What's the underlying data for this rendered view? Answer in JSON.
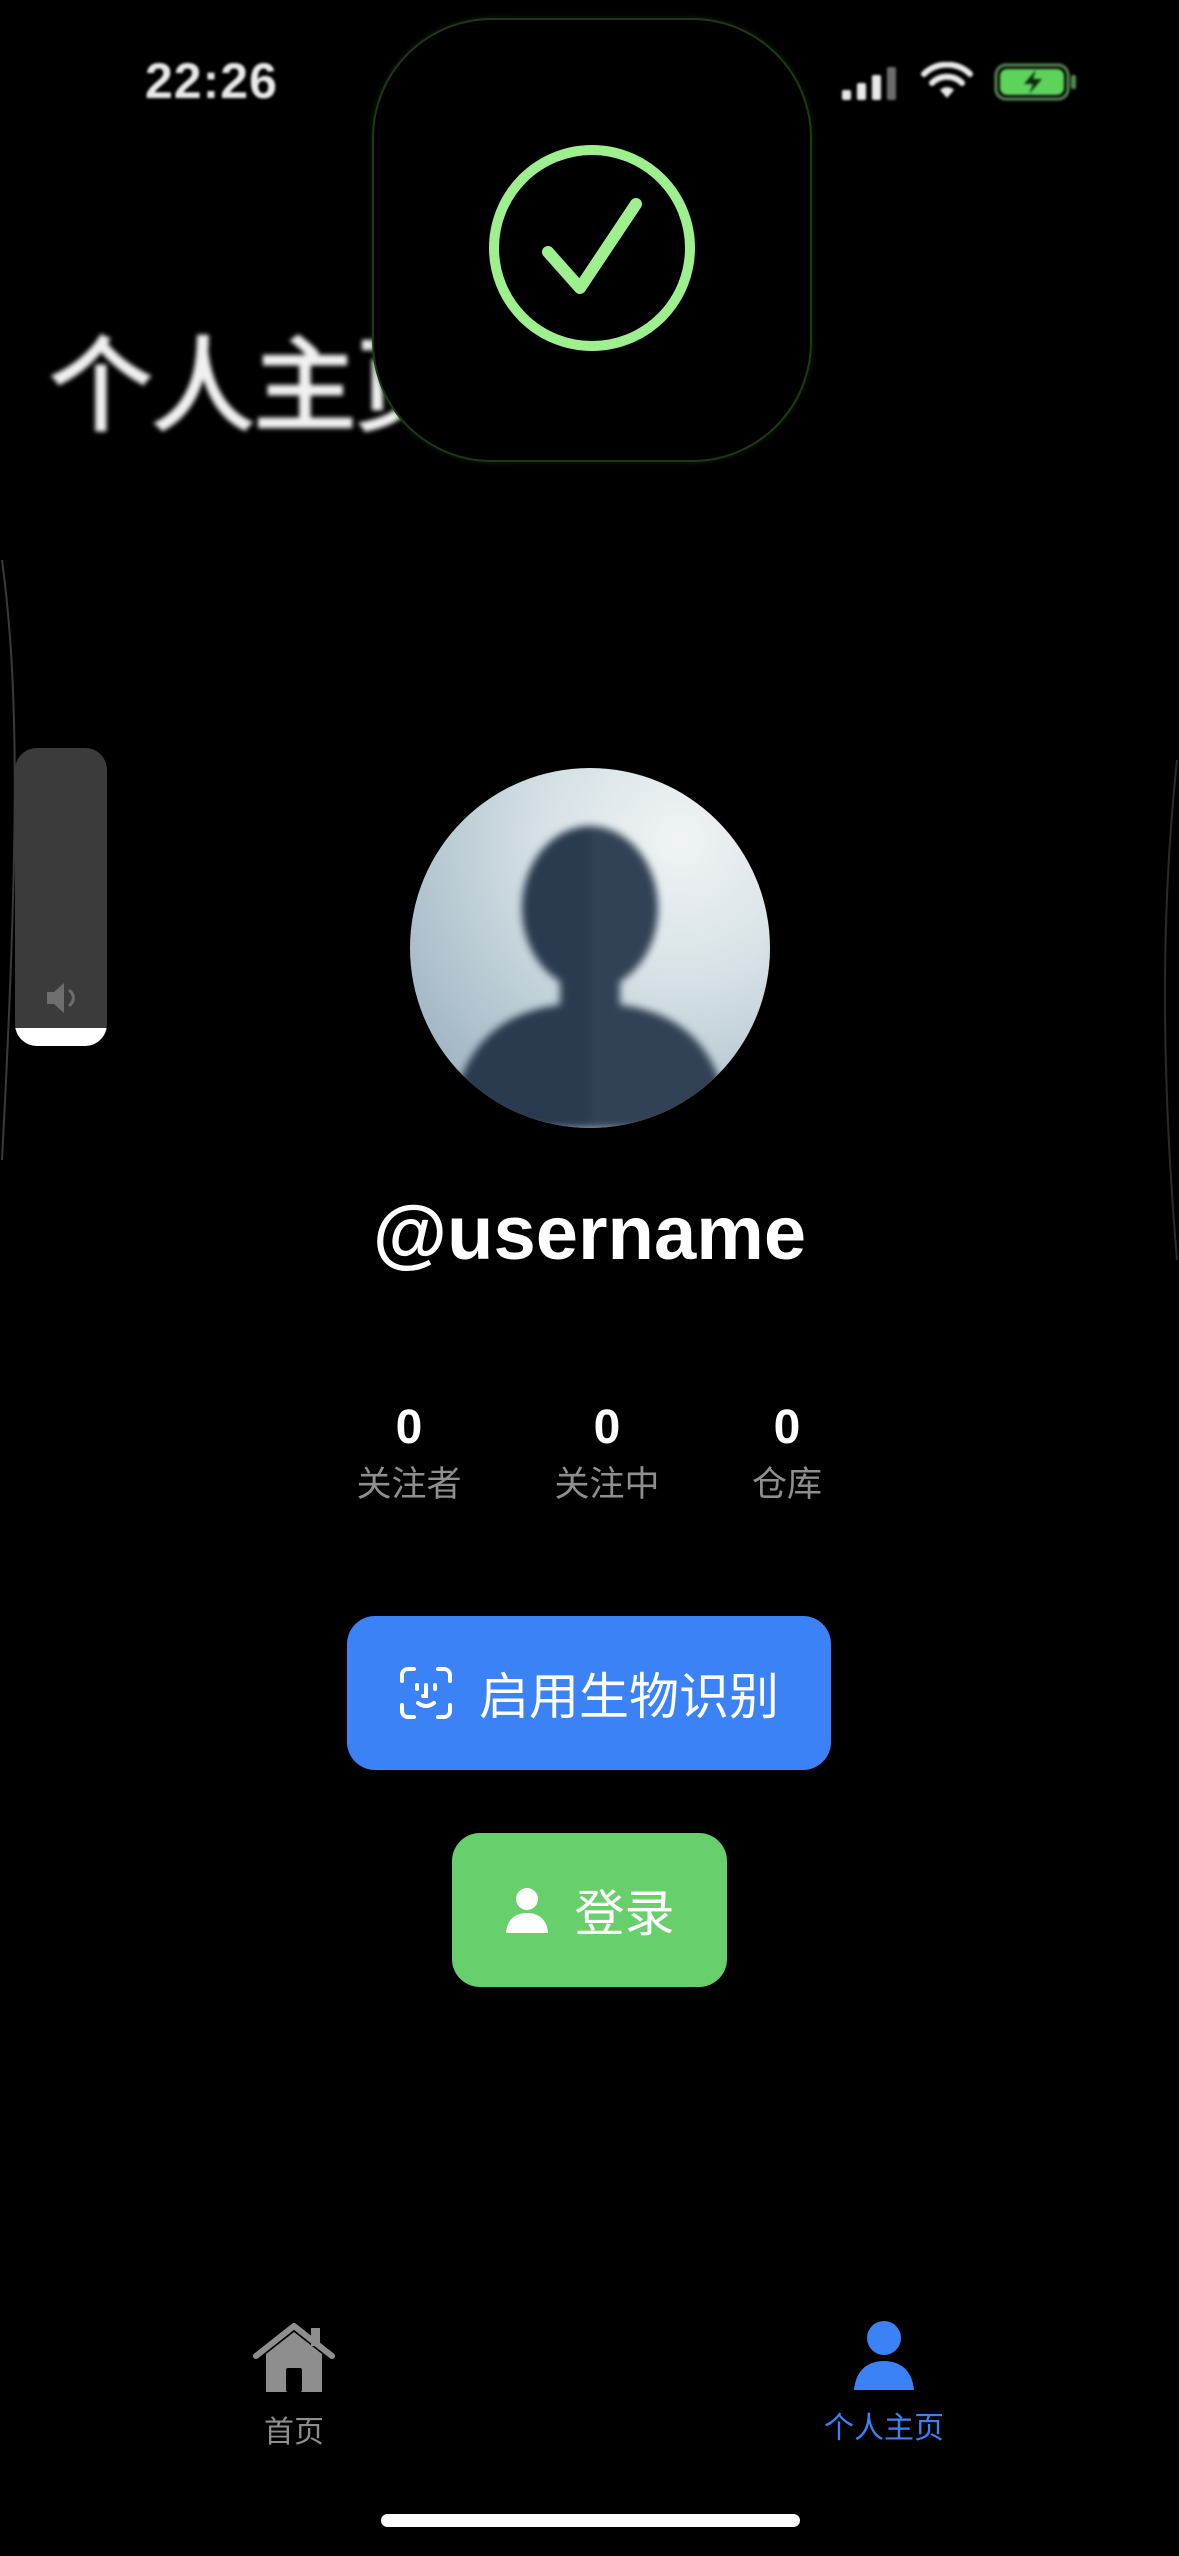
{
  "status_bar": {
    "time": "22:26",
    "signal_icon": "cellular-signal-icon",
    "wifi_icon": "wifi-icon",
    "battery_icon": "battery-charging-icon",
    "battery_color": "#5dd35c"
  },
  "header": {
    "title": "个人主页"
  },
  "success_hud": {
    "icon": "checkmark-circle-icon",
    "accent": "#9ef08f"
  },
  "volume_hud": {
    "icon": "speaker-icon",
    "level": 0.06
  },
  "profile": {
    "avatar_icon": "person-silhouette",
    "username": "@username",
    "stats": [
      {
        "value": "0",
        "label": "关注者"
      },
      {
        "value": "0",
        "label": "关注中"
      },
      {
        "value": "0",
        "label": "仓库"
      }
    ]
  },
  "actions": {
    "biometric_label": "启用生物识别",
    "biometric_icon": "face-id-icon",
    "biometric_color": "#3b82f6",
    "login_label": "登录",
    "login_icon": "person-icon",
    "login_color": "#67cf6b"
  },
  "tab_bar": {
    "tabs": [
      {
        "label": "首页",
        "icon": "house-icon",
        "active": false
      },
      {
        "label": "个人主页",
        "icon": "person-icon",
        "active": true
      }
    ],
    "active_color": "#3b82f6",
    "inactive_color": "#8e8e8e"
  }
}
